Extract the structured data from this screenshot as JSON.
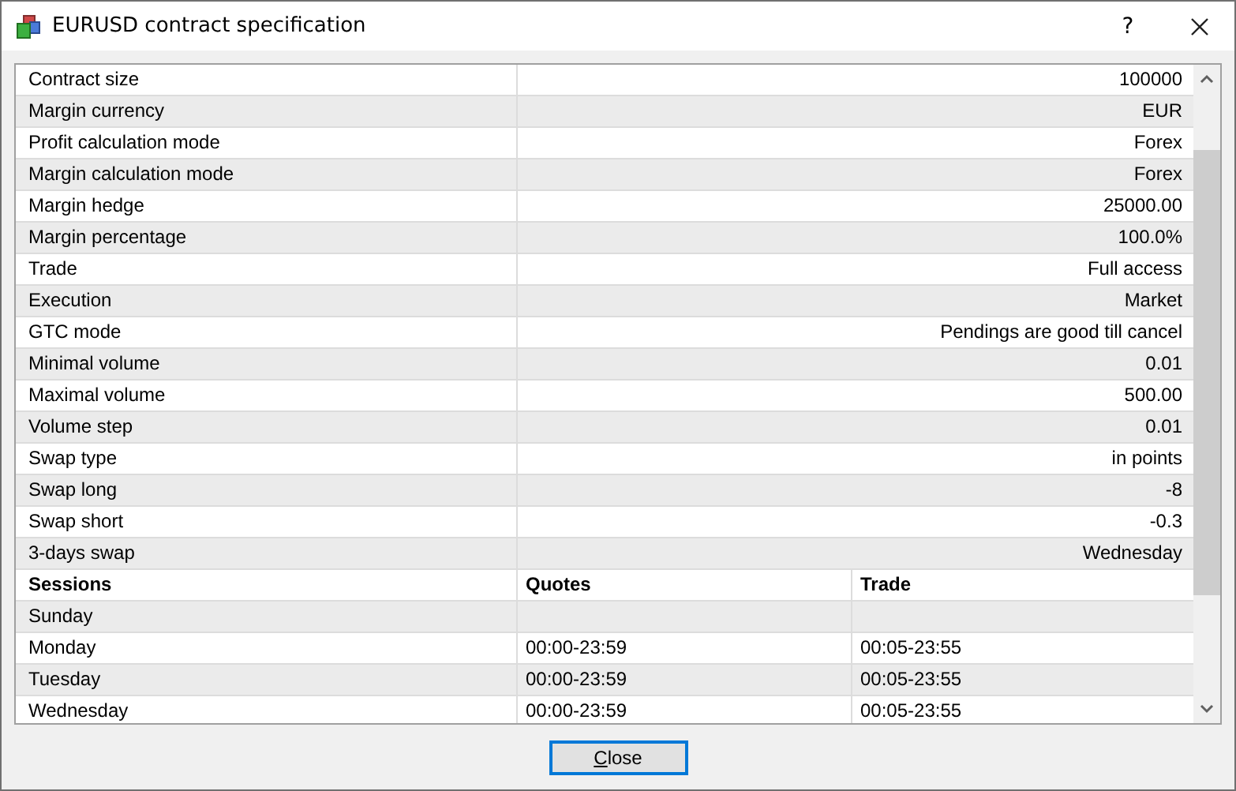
{
  "window": {
    "title": "EURUSD contract specification",
    "help": "?"
  },
  "spec": [
    {
      "label": "Contract size",
      "value": "100000"
    },
    {
      "label": "Margin currency",
      "value": "EUR"
    },
    {
      "label": "Profit calculation mode",
      "value": "Forex"
    },
    {
      "label": "Margin calculation mode",
      "value": "Forex"
    },
    {
      "label": "Margin hedge",
      "value": "25000.00"
    },
    {
      "label": "Margin percentage",
      "value": "100.0%"
    },
    {
      "label": "Trade",
      "value": "Full access"
    },
    {
      "label": "Execution",
      "value": "Market"
    },
    {
      "label": "GTC mode",
      "value": "Pendings are good till cancel"
    },
    {
      "label": "Minimal volume",
      "value": "0.01"
    },
    {
      "label": "Maximal volume",
      "value": "500.00"
    },
    {
      "label": "Volume step",
      "value": "0.01"
    },
    {
      "label": "Swap type",
      "value": "in points"
    },
    {
      "label": "Swap long",
      "value": "-8"
    },
    {
      "label": "Swap short",
      "value": "-0.3"
    },
    {
      "label": "3-days swap",
      "value": "Wednesday"
    }
  ],
  "sessions": {
    "columns": [
      "Sessions",
      "Quotes",
      "Trade"
    ],
    "rows": [
      {
        "day": "Sunday"
      },
      {
        "day": "Monday",
        "quotes": "00:00-23:59",
        "trade": "00:05-23:55"
      },
      {
        "day": "Tuesday",
        "quotes": "00:00-23:59",
        "trade": "00:05-23:55"
      },
      {
        "day": "Wednesday",
        "quotes": "00:00-23:59",
        "trade": "00:05-23:55"
      }
    ]
  },
  "buttons": [
    "Close"
  ]
}
